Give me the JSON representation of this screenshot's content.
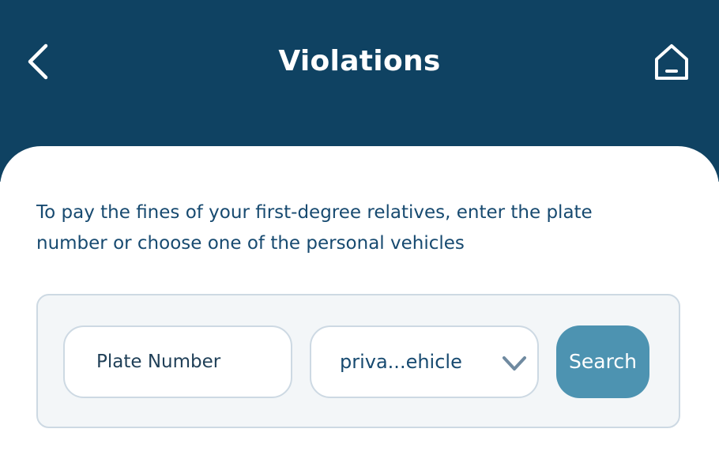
{
  "header": {
    "title": "Violations",
    "back_icon": "chevron-left-icon",
    "home_icon": "home-icon",
    "background_color": "#0f4262"
  },
  "intro": {
    "text": "To pay the fines of your first-degree relatives, enter the plate number or choose one of the personal vehicles"
  },
  "search": {
    "plate_placeholder": "Plate Number",
    "vehicle_selected": "priva...ehicle",
    "dropdown_icon": "chevron-down-icon",
    "search_label": "Search",
    "accent_color": "#4d93b1"
  }
}
